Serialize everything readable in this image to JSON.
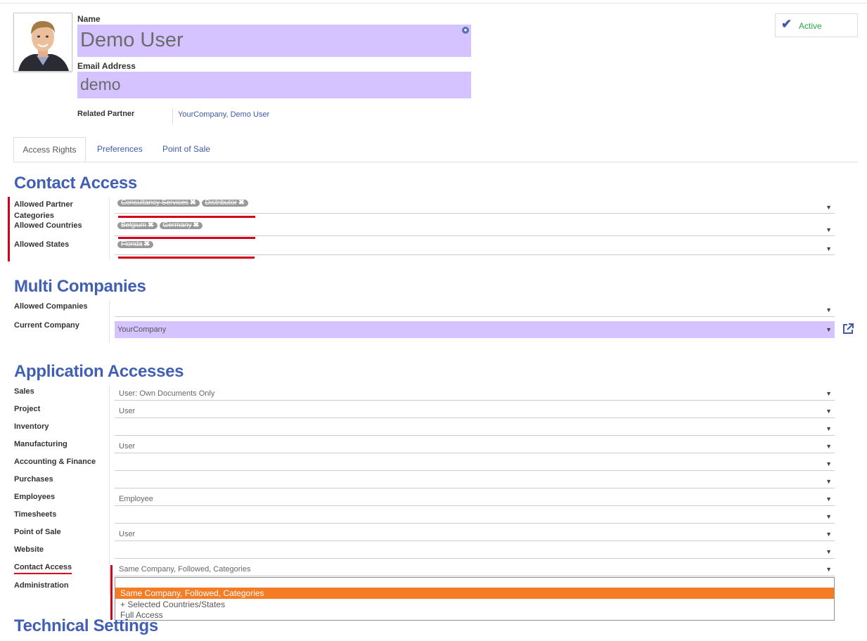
{
  "header": {
    "name_label": "Name",
    "name_value": "Demo User",
    "email_label": "Email Address",
    "email_value": "demo",
    "related_partner_label": "Related Partner",
    "related_partner_value": "YourCompany, Demo User",
    "active_label": "Active"
  },
  "tabs": [
    {
      "label": "Access Rights",
      "active": true
    },
    {
      "label": "Preferences",
      "active": false
    },
    {
      "label": "Point of Sale",
      "active": false
    }
  ],
  "contact_access": {
    "title": "Contact Access",
    "allowed_partner_categories_label": "Allowed Partner Categories",
    "allowed_partner_categories": [
      "Consultancy Services",
      "Distributor"
    ],
    "allowed_countries_label": "Allowed Countries",
    "allowed_countries": [
      "Belgium",
      "Germany"
    ],
    "allowed_states_label": "Allowed States",
    "allowed_states": [
      "Florida"
    ]
  },
  "multi_companies": {
    "title": "Multi Companies",
    "allowed_companies_label": "Allowed Companies",
    "allowed_companies_value": "",
    "current_company_label": "Current Company",
    "current_company_value": "YourCompany"
  },
  "application_accesses": {
    "title": "Application Accesses",
    "rows": [
      {
        "label": "Sales",
        "value": "User: Own Documents Only"
      },
      {
        "label": "Project",
        "value": "User"
      },
      {
        "label": "Inventory",
        "value": ""
      },
      {
        "label": "Manufacturing",
        "value": "User"
      },
      {
        "label": "Accounting & Finance",
        "value": ""
      },
      {
        "label": "Purchases",
        "value": ""
      },
      {
        "label": "Employees",
        "value": "Employee"
      },
      {
        "label": "Timesheets",
        "value": ""
      },
      {
        "label": "Point of Sale",
        "value": "User"
      },
      {
        "label": "Website",
        "value": ""
      },
      {
        "label": "Contact Access",
        "value": "Same Company, Followed, Categories"
      }
    ],
    "administration_label": "Administration"
  },
  "dropdown": {
    "options": [
      "Same Company, Followed, Categories",
      "+ Selected Countries/States",
      "Full Access"
    ],
    "highlighted_index": 0
  },
  "technical_settings": {
    "title": "Technical Settings"
  },
  "colors": {
    "heading": "#4160b4",
    "field_highlight": "#d5c3ff",
    "dropdown_highlight": "#f47c25",
    "annotation_red": "#d0021b",
    "link": "#3e59a8",
    "active_text": "#28a745"
  },
  "icons": {
    "active": "checkmark-icon",
    "translate": "globe-icon",
    "external": "external-link-icon",
    "select": "caret-down-icon",
    "remove_tag": "x-icon"
  }
}
